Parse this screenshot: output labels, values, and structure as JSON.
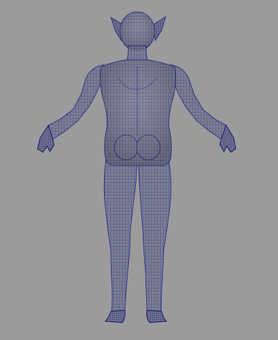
{
  "viewport": {
    "background_color": "#9b9b9b",
    "view": "back"
  },
  "model": {
    "subject": "female-elf-figure",
    "pose": "A-pose",
    "display_mode": "wireframe-on-shaded",
    "surface_color": "#7d7f90",
    "wire_color": "#1c1c86",
    "dense_wire_color": "#12126e"
  }
}
